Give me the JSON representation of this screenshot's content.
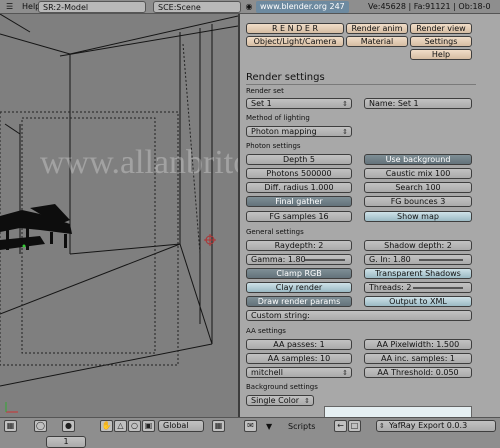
{
  "topbar": {
    "help": "Help",
    "screen": "SR:2-Model",
    "scene": "SCE:Scene",
    "url": "www.blender.org 247",
    "stats": "Ve:45628 | Fa:91121 | Ob:18-0"
  },
  "watermark": "www.allanbrito.com",
  "panel": {
    "buttons": {
      "render": "R E N D E R",
      "render_anim": "Render anim",
      "render_view": "Render view",
      "object_light_camera": "Object/Light/Camera",
      "material": "Material",
      "settings": "Settings",
      "help": "Help"
    },
    "title": "Render settings",
    "render_set": {
      "label": "Render set",
      "value": "Set 1",
      "name": "Name: Set 1"
    },
    "lighting": {
      "label": "Method of lighting",
      "value": "Photon mapping"
    },
    "photon": {
      "label": "Photon settings",
      "depth": "Depth 5",
      "use_background": "Use background",
      "photons": "Photons 500000",
      "caustic_mix": "Caustic mix 100",
      "diff_radius": "Diff. radius 1.000",
      "search": "Search 100",
      "final_gather": "Final gather",
      "fg_bounces": "FG bounces 3",
      "fg_samples": "FG samples 16",
      "show_map": "Show map"
    },
    "general": {
      "label": "General settings",
      "raydepth": "Raydepth: 2",
      "shadow_depth": "Shadow depth: 2",
      "gamma": "Gamma: 1.80",
      "g_in": "G. In: 1.80",
      "clamp_rgb": "Clamp RGB",
      "transparent_shadows": "Transparent Shadows",
      "clay_render": "Clay render",
      "threads": "Threads: 2",
      "draw_render_params": "Draw render params",
      "output_xml": "Output to XML",
      "custom_string": "Custom string:"
    },
    "aa": {
      "label": "AA settings",
      "passes": "AA passes: 1",
      "pixelwidth": "AA Pixelwidth: 1.500",
      "samples": "AA samples: 10",
      "inc_samples": "AA inc. samples: 1",
      "filter": "mitchell",
      "threshold": "AA Threshold: 0.050"
    },
    "background": {
      "label": "Background settings",
      "value": "Single Color"
    }
  },
  "bottombar": {
    "mode": "Global",
    "scripts": "Scripts",
    "script_name": "YafRay Export 0.0.3",
    "frame": "1"
  },
  "colors": {
    "accent_dark": "#63727a",
    "accent_blue": "#9bbac4",
    "header_tan": "#d6bda3"
  }
}
